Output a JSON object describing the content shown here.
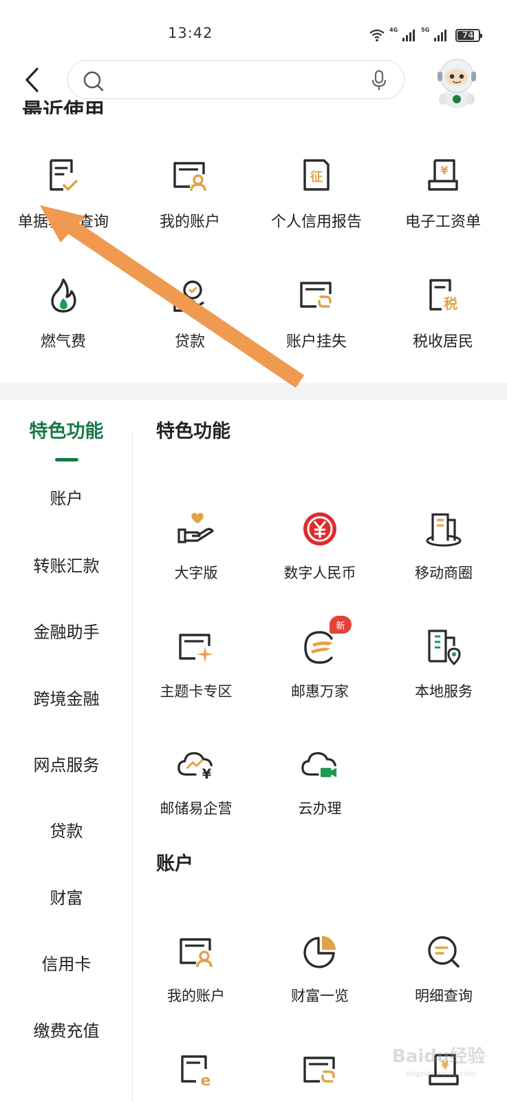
{
  "status_bar": {
    "time": "13:42",
    "network_1": "4G",
    "network_2": "5G",
    "battery": "74",
    "battery_level": 0.74
  },
  "header": {
    "search_placeholder": "",
    "back_icon": "chevron-left-icon",
    "search_icon": "search-icon",
    "mic_icon": "microphone-icon",
    "avatar_icon": "robot-assistant-avatar"
  },
  "recent": {
    "title": "最近使用",
    "items": [
      {
        "label": "单据验证查询",
        "icon": "document-check-icon"
      },
      {
        "label": "我的账户",
        "icon": "account-card-icon"
      },
      {
        "label": "个人信用报告",
        "icon": "credit-report-icon"
      },
      {
        "label": "电子工资单",
        "icon": "payslip-icon"
      },
      {
        "label": "燃气费",
        "icon": "gas-flame-icon"
      },
      {
        "label": "贷款",
        "icon": "loan-icon"
      },
      {
        "label": "账户挂失",
        "icon": "account-lock-icon"
      },
      {
        "label": "税收居民",
        "icon": "tax-icon"
      }
    ]
  },
  "nav": {
    "items": [
      {
        "label": "特色功能",
        "active": true
      },
      {
        "label": "账户"
      },
      {
        "label": "转账汇款"
      },
      {
        "label": "金融助手"
      },
      {
        "label": "跨境金融"
      },
      {
        "label": "网点服务"
      },
      {
        "label": "贷款"
      },
      {
        "label": "财富"
      },
      {
        "label": "信用卡"
      },
      {
        "label": "缴费充值"
      }
    ]
  },
  "content": {
    "featured": {
      "title": "特色功能",
      "items": [
        {
          "label": "大字版",
          "icon": "heart-hand-icon"
        },
        {
          "label": "数字人民币",
          "icon": "digital-rmb-icon"
        },
        {
          "label": "移动商圈",
          "icon": "store-building-icon"
        },
        {
          "label": "主题卡专区",
          "icon": "theme-card-icon"
        },
        {
          "label": "邮惠万家",
          "icon": "postal-benefit-icon",
          "badge": "新"
        },
        {
          "label": "本地服务",
          "icon": "local-service-icon"
        },
        {
          "label": "邮储易企营",
          "icon": "cloud-yuan-icon"
        },
        {
          "label": "云办理",
          "icon": "cloud-video-icon"
        }
      ]
    },
    "account": {
      "title": "账户",
      "items": [
        {
          "label": "我的账户",
          "icon": "account-card-icon"
        },
        {
          "label": "财富一览",
          "icon": "pie-chart-icon"
        },
        {
          "label": "明细查询",
          "icon": "search-detail-icon"
        }
      ]
    }
  },
  "watermark": {
    "text": "Baidu经验",
    "sub": "jingyan.baidu.com"
  },
  "colors": {
    "brand_green": "#17784a",
    "icon_dark": "#2a2a2a",
    "icon_gold": "#e2a24a",
    "red": "#e5413b",
    "arrow": "#ef9a50"
  }
}
